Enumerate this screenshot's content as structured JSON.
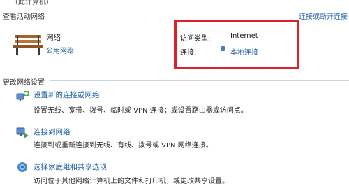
{
  "top_fragment": "(此计算机)",
  "active_networks": {
    "header": "查看活动网络",
    "connect_link": "连接或断开连接",
    "network_name": "网络",
    "network_type": "公用网络",
    "access_type_label": "访问类型:",
    "access_type_value": "Internet",
    "connection_label": "连接:",
    "connection_value": "本地连接",
    "highlight_color": "#d8232a"
  },
  "change_settings": {
    "header": "更改网络设置",
    "tasks": [
      {
        "title": "设置新的连接或网络",
        "desc": "设置无线、宽带、拨号、临时或 VPN 连接；或设置路由器或访问点。",
        "icon": "new-connection-icon"
      },
      {
        "title": "连接到网络",
        "desc": "连接到或重新连接到无线、有线、拨号或 VPN 网络连接。",
        "icon": "connect-network-icon"
      },
      {
        "title": "选择家庭组和共享选项",
        "desc": "访问位于其他网络计算机上的文件和打印机，或更改共享设置。",
        "icon": "homegroup-icon"
      }
    ]
  },
  "colors": {
    "link": "#1f5fa8",
    "divider": "#c9d4e0"
  }
}
